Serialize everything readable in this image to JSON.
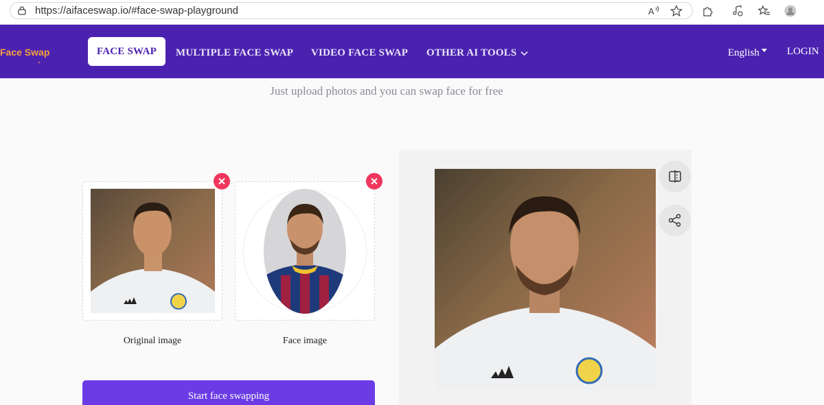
{
  "browser": {
    "url": "https://aifaceswap.io/#face-swap-playground"
  },
  "nav": {
    "logo": "Face Swap",
    "active_tab": "FACE SWAP",
    "items": [
      {
        "label": "MULTIPLE FACE SWAP"
      },
      {
        "label": "VIDEO FACE SWAP"
      },
      {
        "label": "OTHER AI TOOLS"
      }
    ],
    "language": "English",
    "login": "LOGIN"
  },
  "tagline": "Just upload photos and you can swap face for free",
  "uploads": {
    "original_caption": "Original image",
    "face_caption": "Face image"
  },
  "start_button": "Start face swapping",
  "colors": {
    "nav_bg": "#4b22b0",
    "accent": "#6b3ce6",
    "close": "#f0365c",
    "logo": "#f6a13b"
  }
}
